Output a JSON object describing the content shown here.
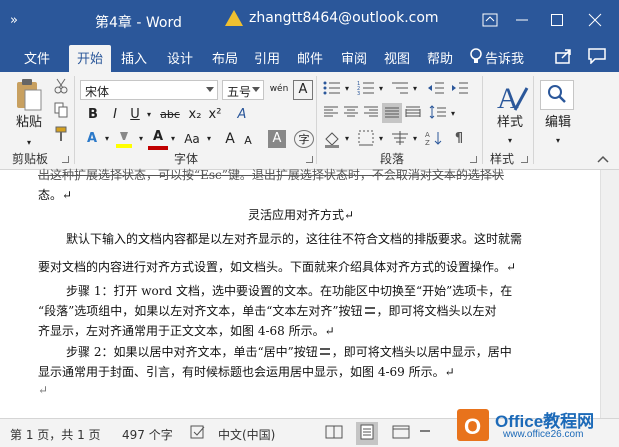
{
  "titlebar": {
    "qat": "»",
    "title": "第4章 - Word",
    "account": "zhangtt8464@outlook.com",
    "window_controls": [
      "ribbon-display-icon",
      "minimize-icon",
      "maximize-icon",
      "close-icon"
    ]
  },
  "tabs": [
    {
      "label": "文件"
    },
    {
      "label": "开始",
      "active": true
    },
    {
      "label": "插入"
    },
    {
      "label": "设计"
    },
    {
      "label": "布局"
    },
    {
      "label": "引用"
    },
    {
      "label": "邮件"
    },
    {
      "label": "审阅"
    },
    {
      "label": "视图"
    },
    {
      "label": "帮助"
    }
  ],
  "tell_me": "告诉我",
  "ribbon": {
    "clipboard": {
      "paste": "粘贴",
      "label": "剪贴板"
    },
    "font": {
      "font_name": "宋体",
      "font_size": "五号",
      "label": "字体",
      "bold": "B",
      "italic": "I",
      "underline": "U",
      "strike": "abc",
      "sub": "x₂",
      "sup": "x²",
      "clear": "A",
      "grow": "A",
      "shrink": "A",
      "char_shade": "A",
      "case": "Aa",
      "phonetic": "wén",
      "border_char": "A"
    },
    "paragraph": {
      "label": "段落"
    },
    "styles": {
      "button": "样式",
      "label": "样式"
    },
    "editing": {
      "button": "编辑"
    }
  },
  "document": {
    "line_partial": "出这种扩展选择状态，可以按“Esc”键。退出扩展选择状态时，不会取消对文本的选择状",
    "line_partial2": "态。↵",
    "heading": "灵活应用对齐方式↵",
    "p1_line1": "默认下输入的文档内容都是以左对齐显示的，这往往不符合文档的排版要求。这时就需",
    "p1_line2": "要对文档的内容进行对齐方式设置，如文档头。下面就来介绍具体对齐方式的设置操作。↵",
    "p2_line1": "步骤 1：打开 word 文档，选中要设置的文本。在功能区中切换至“开始”选项卡，在",
    "p2_line2": "“段落”选项组中，如果以左对齐文本，单击“文本左对齐”按钮",
    "p2_line2b": "，即可将文档头以左对",
    "p2_line3": "齐显示，左对齐通常用于正文文本，如图 4-68 所示。↵",
    "p3_line1": "步骤 2：如果以居中对齐文本，单击“居中”按钮",
    "p3_line1b": "，即可将文档头以居中显示，居中",
    "p3_line2": "显示通常用于封面、引言，有时候标题也会运用居中显示，如图 4-69 所示。↵",
    "end_mark": "↵"
  },
  "statusbar": {
    "page": "第 1 页，共 1 页",
    "words": "497 个字",
    "language": "中文(中国)"
  },
  "watermark": {
    "brand": "Office教程网",
    "url": "www.office26.com"
  },
  "colors": {
    "accent": "#2b579a",
    "ribbon_bg": "#f3f3f3",
    "font_color_bar": "#c00000",
    "highlight_bar": "#ffff00"
  }
}
